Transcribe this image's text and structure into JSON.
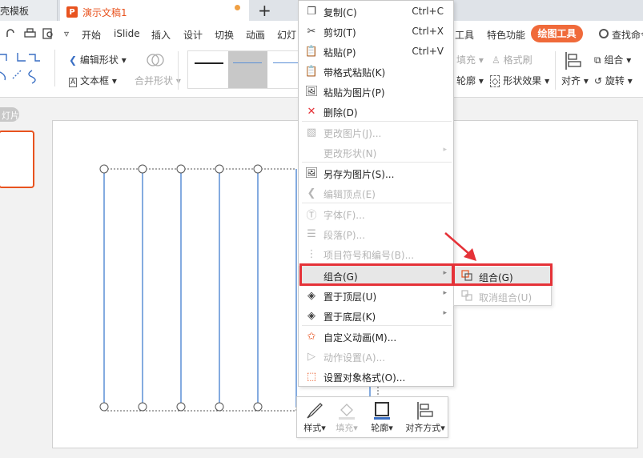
{
  "titlebar": {
    "tab1_label": "稻壳模板",
    "tab2_label": "演示文稿1",
    "tab2_icon": "P",
    "new_tab": "+"
  },
  "menu": {
    "items": [
      "开始",
      "iSlide",
      "插入",
      "设计",
      "切换",
      "动画",
      "幻灯"
    ],
    "right_items": [
      "工具",
      "特色功能"
    ],
    "drawing_tools": "绘图工具",
    "search": "查找命令"
  },
  "ribbon": {
    "edit_shape": "编辑形状",
    "text_box": "文本框",
    "merge_shape": "合并形状",
    "fill": "填充",
    "format_brush": "格式刷",
    "outline": "轮廓",
    "shape_effect": "形状效果",
    "align": "对齐",
    "group": "组合",
    "rotate": "旋转"
  },
  "leftpane": {
    "slides_label": "灯片"
  },
  "context_menu": {
    "items": [
      {
        "label": "复制(C)",
        "shortcut": "Ctrl+C",
        "icon": "copy-icon"
      },
      {
        "label": "剪切(T)",
        "shortcut": "Ctrl+X",
        "icon": "scissors-icon"
      },
      {
        "label": "粘贴(P)",
        "shortcut": "Ctrl+V",
        "icon": "paste-icon"
      },
      {
        "label": "带格式粘贴(K)",
        "icon": "paste-format-icon"
      },
      {
        "label": "粘贴为图片(P)",
        "icon": "paste-picture-icon"
      },
      {
        "label": "删除(D)",
        "icon": "delete-icon"
      },
      {
        "label": "更改图片(J)...",
        "icon": "change-picture-icon",
        "disabled": true
      },
      {
        "label": "更改形状(N)",
        "disabled": true
      },
      {
        "label": "另存为图片(S)...",
        "icon": "save-picture-icon"
      },
      {
        "label": "编辑顶点(E)",
        "icon": "edit-points-icon",
        "disabled": true
      },
      {
        "label": "字体(F)...",
        "icon": "font-icon",
        "disabled": true
      },
      {
        "label": "段落(P)...",
        "icon": "paragraph-icon",
        "disabled": true
      },
      {
        "label": "项目符号和编号(B)...",
        "icon": "bullets-icon",
        "disabled": true
      },
      {
        "label": "组合(G)"
      },
      {
        "label": "置于顶层(U)",
        "icon": "bring-front-icon"
      },
      {
        "label": "置于底层(K)",
        "icon": "send-back-icon"
      },
      {
        "label": "自定义动画(M)...",
        "icon": "animation-icon"
      },
      {
        "label": "动作设置(A)...",
        "icon": "action-icon",
        "disabled": true
      },
      {
        "label": "设置对象格式(O)...",
        "icon": "format-object-icon"
      }
    ]
  },
  "submenu": {
    "group": "组合(G)",
    "ungroup": "取消组合(U)"
  },
  "minibar": {
    "style": "样式",
    "fill": "填充",
    "outline": "轮廓",
    "align": "对齐方式"
  },
  "colors": {
    "accent": "#f06a3a",
    "highlight_box": "#e53238",
    "line_shape": "#5b8fd6"
  }
}
